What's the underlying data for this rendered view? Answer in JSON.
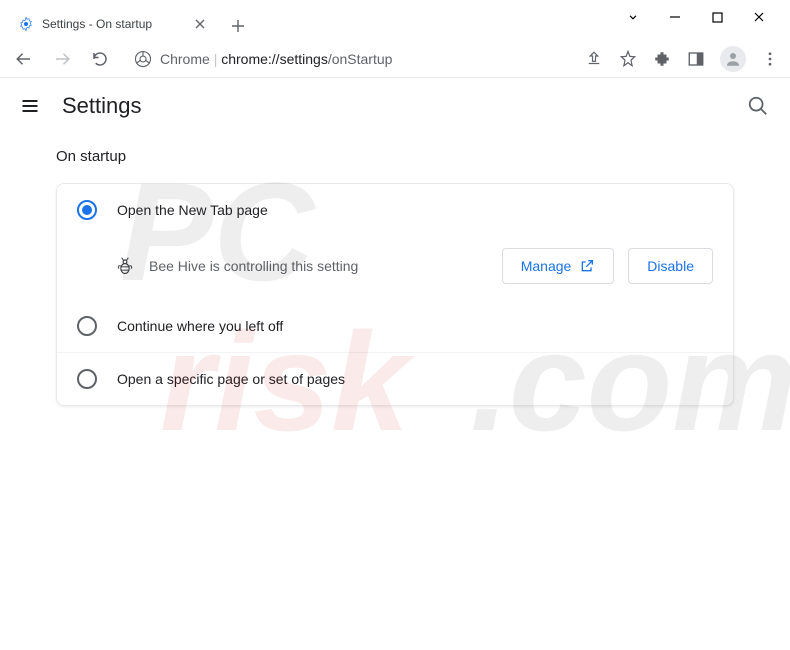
{
  "window": {
    "tab_title": "Settings - On startup"
  },
  "omnibox": {
    "scheme_label": "Chrome",
    "origin": "chrome://settings",
    "path": "/onStartup"
  },
  "header": {
    "title": "Settings"
  },
  "section": {
    "title": "On startup"
  },
  "options": {
    "open_new_tab": "Open the New Tab page",
    "continue": "Continue where you left off",
    "specific": "Open a specific page or set of pages"
  },
  "controlled": {
    "message": "Bee Hive is controlling this setting",
    "manage_label": "Manage",
    "disable_label": "Disable"
  }
}
